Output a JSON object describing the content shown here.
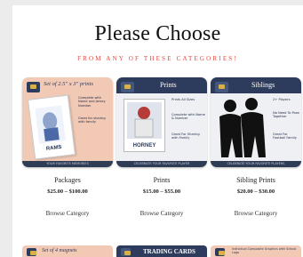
{
  "heading": {
    "title": "Please Choose",
    "subtitle": "FROM ANY OF THESE CATEGORIES!"
  },
  "colors": {
    "accent": "#e0463c",
    "navy": "#2d3c5c",
    "peach": "#f2c9b5"
  },
  "categories": [
    {
      "name": "Packages",
      "price": "$25.00 – $100.00",
      "link": "Browse Category",
      "image": {
        "heading": "Set of 2.5\" x 3\" prints",
        "features": [
          "Complete with Name and Jersey Number",
          "Great for sharing with family"
        ],
        "band": "YOUR FAVORITE MEMORIES"
      }
    },
    {
      "name": "Prints",
      "price": "$15.00 – $55.00",
      "link": "Browse Category",
      "image": {
        "heading": "Prints",
        "features": [
          "Prints All Sizes",
          "Complete with Name & Number",
          "Great For Sharing with Family"
        ],
        "jersey_name": "HORNEY",
        "band": "CELEBRATE YOUR FAVORITE PLAYER"
      }
    },
    {
      "name": "Sibling Prints",
      "price": "$20.00 – $30.00",
      "link": "Browse Category",
      "image": {
        "heading": "Siblings",
        "features": [
          "2+ Players",
          "No Need To Pose Together",
          "Great For Football Family"
        ],
        "band": "CELEBRATE YOUR FAVORITE PLAYERS"
      }
    }
  ],
  "next_row": [
    {
      "heading": "Set of 4 magnets"
    },
    {
      "heading": "TRADING CARDS"
    },
    {
      "heading": "Individual Composite Graphics with School Logo"
    }
  ]
}
